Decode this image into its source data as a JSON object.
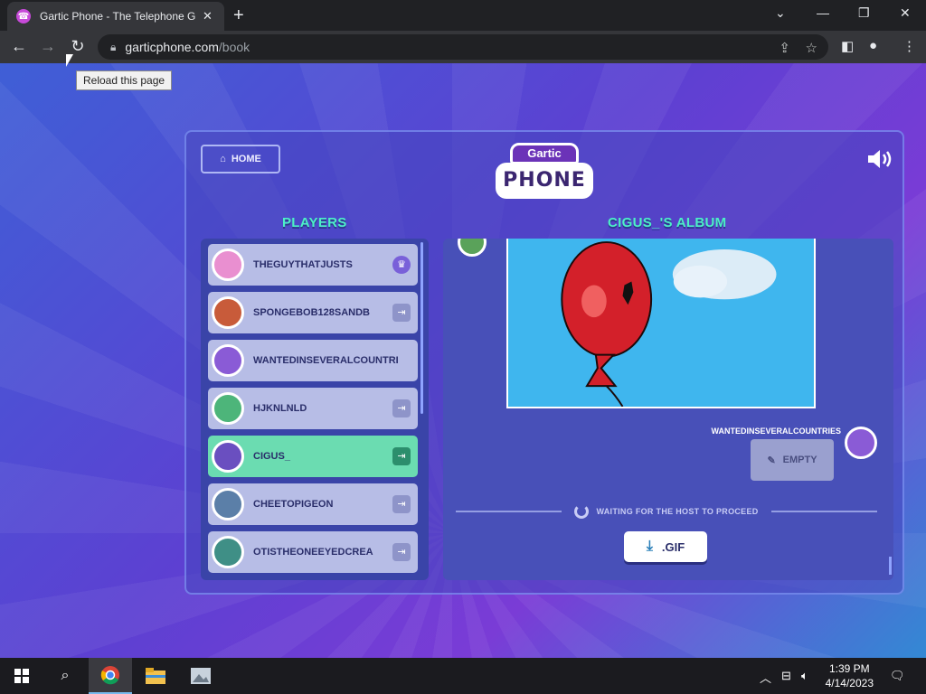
{
  "browser": {
    "tab_title": "Gartic Phone - The Telephone Ga",
    "tab_favicon": "☎",
    "url_host": "garticphone.com",
    "url_path": "/book",
    "tooltip": "Reload this page"
  },
  "game": {
    "home_label": "HOME",
    "logo_top": "Gartic",
    "logo_bottom": "PHONE",
    "players_title": "PLAYERS",
    "album_title": "CIGUS_'S ALBUM",
    "players": [
      {
        "name": "THEGUYTHATJUSTS",
        "badge": "♛",
        "active": false,
        "avatar_color": "#e98fd0"
      },
      {
        "name": "SPONGEBOB128SANDB",
        "badge": "⇥",
        "active": false,
        "avatar_color": "#c85b3a"
      },
      {
        "name": "WANTEDINSEVERALCOUNTRI",
        "badge": "",
        "active": false,
        "avatar_color": "#8a5bd6"
      },
      {
        "name": "HJKNLNLD",
        "badge": "⇥",
        "active": false,
        "avatar_color": "#4db57a"
      },
      {
        "name": "CIGUS_",
        "badge": "⇥",
        "active": true,
        "avatar_color": "#6a4fc0"
      },
      {
        "name": "CHEETOPIGEON",
        "badge": "⇥",
        "active": false,
        "avatar_color": "#5b7fa8"
      },
      {
        "name": "OTISTHEONEEYEDCREA",
        "badge": "⇥",
        "active": false,
        "avatar_color": "#3f8f86"
      }
    ],
    "drawer_name": "WANTEDINSEVERALCOUNTRIES",
    "empty_label": "EMPTY",
    "waiting_text": "WAITING FOR THE HOST TO PROCEED",
    "gif_label": ".GIF"
  },
  "taskbar": {
    "time": "1:39 PM",
    "date": "4/14/2023"
  },
  "colors": {
    "accent_teal": "#4cf0c6",
    "active_player": "#6bdcb1"
  }
}
